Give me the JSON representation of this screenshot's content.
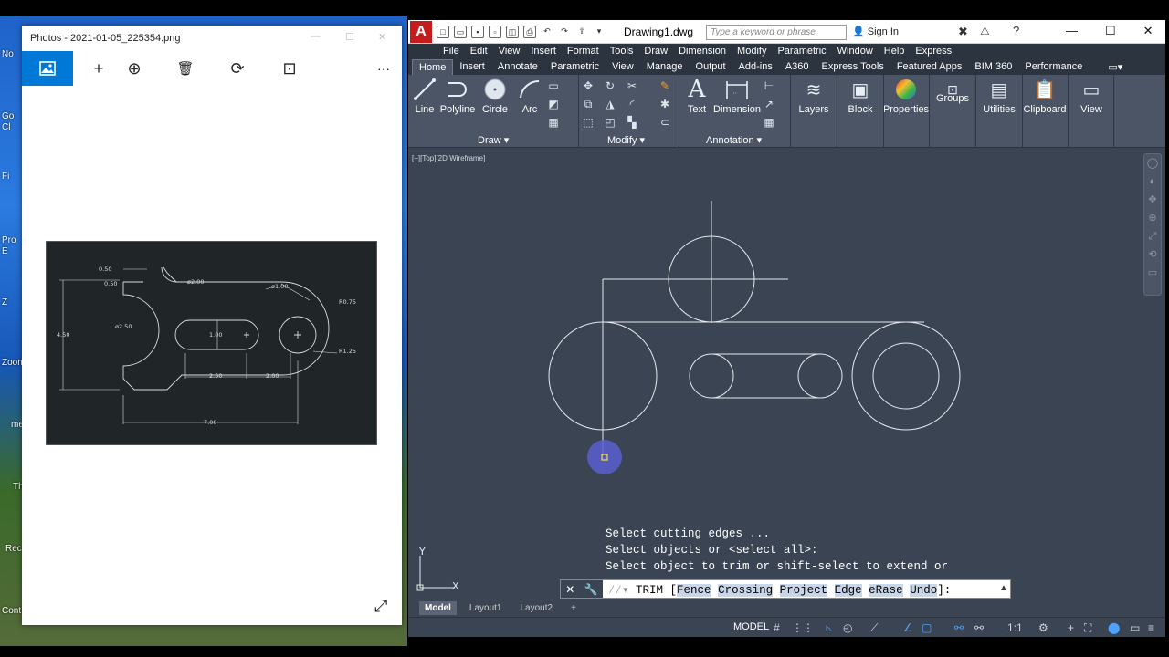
{
  "desktop": {
    "labels": [
      "No",
      "Go",
      "Cl",
      "Fi",
      "Pro",
      "E",
      "Z",
      "Zoom",
      "me",
      "Th",
      "Rec",
      "Cont"
    ]
  },
  "photos": {
    "title": "Photos - 2021-01-05_225354.png",
    "window_controls": [
      "—",
      "☐",
      "✕"
    ],
    "toolbar": {
      "add": "+",
      "zoom": "⊕",
      "delete": "🗑",
      "rotate": "⟳",
      "crop": "⊡",
      "more": "···"
    },
    "expand": "⤢",
    "image": {
      "dims": {
        "d050a": "0.50",
        "d050b": "0.50",
        "d450": "4.50",
        "d250": "ø2.50",
        "r200": "ø2.00",
        "d100circle": "ø1.00",
        "r075": "R0.75",
        "r125": "R1.25",
        "slot100": "1.00",
        "len250": "2.50",
        "len200": "2.00",
        "len700": "7.00"
      }
    }
  },
  "acad": {
    "app_letter": "A",
    "doc_title": "Drawing1.dwg",
    "search_placeholder": "Type a keyword or phrase",
    "signin": "Sign In",
    "window_controls": [
      "—",
      "☐",
      "✕"
    ],
    "menu": [
      "File",
      "Edit",
      "View",
      "Insert",
      "Format",
      "Tools",
      "Draw",
      "Dimension",
      "Modify",
      "Parametric",
      "Window",
      "Help",
      "Express"
    ],
    "tabs": [
      "Home",
      "Insert",
      "Annotate",
      "Parametric",
      "View",
      "Manage",
      "Output",
      "Add-ins",
      "A360",
      "Express Tools",
      "Featured Apps",
      "BIM 360",
      "Performance"
    ],
    "ribbon": {
      "line": "Line",
      "polyline": "Polyline",
      "circle": "Circle",
      "arc": "Arc",
      "text": "Text",
      "dimension": "Dimension",
      "layers": "Layers",
      "block": "Block",
      "properties": "Properties",
      "groups": "Groups",
      "utilities": "Utilities",
      "clipboard": "Clipboard",
      "view": "View",
      "panel_draw": "Draw ▾",
      "panel_modify": "Modify ▾",
      "panel_annotation": "Annotation ▾"
    },
    "viewport_label": "[−][Top][2D Wireframe]",
    "ucs": {
      "y": "Y",
      "x": "X"
    },
    "cmd_history": [
      "Select cutting edges ...",
      "Select objects or <select all>:",
      "Select object to trim or shift-select to extend or"
    ],
    "cmd_prompt": {
      "prefix": "TRIM [",
      "fence": "Fence",
      "crossing": "Crossing",
      "project": "Project",
      "edge": "Edge",
      "erase": "eRase",
      "undo": "Undo",
      "suffix": "]:"
    },
    "layouts": [
      "Model",
      "Layout1",
      "Layout2",
      "+"
    ],
    "status": {
      "model": "MODEL",
      "scale": "1:1"
    }
  },
  "colors": {
    "accent": "#0078d7",
    "acad_bg": "#3b4453",
    "ribbon": "#4b5566",
    "logo_red": "#c21c1c"
  }
}
